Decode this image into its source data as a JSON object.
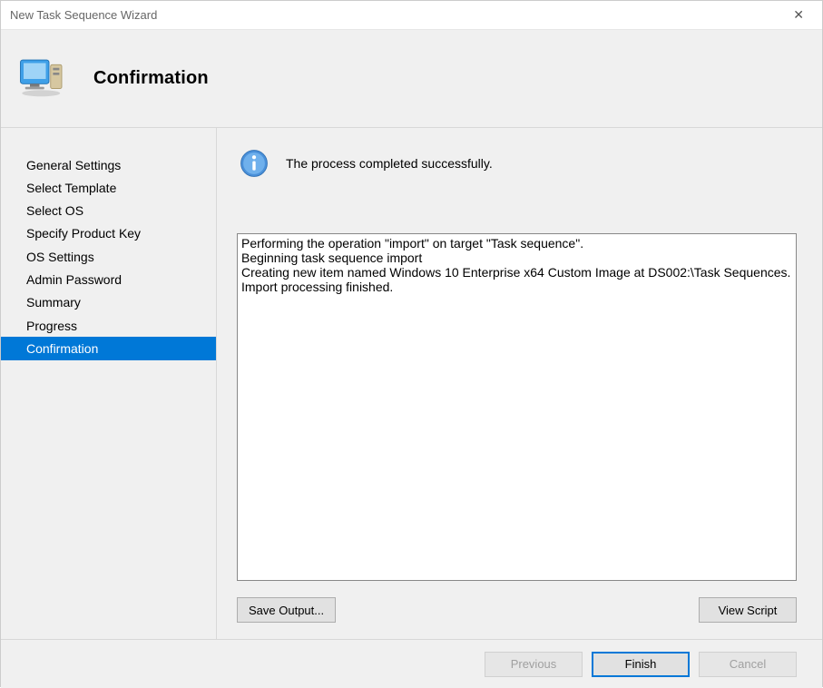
{
  "window": {
    "title": "New Task Sequence Wizard"
  },
  "header": {
    "title": "Confirmation"
  },
  "sidebar": {
    "items": [
      {
        "label": "General Settings",
        "selected": false
      },
      {
        "label": "Select Template",
        "selected": false
      },
      {
        "label": "Select OS",
        "selected": false
      },
      {
        "label": "Specify Product Key",
        "selected": false
      },
      {
        "label": "OS Settings",
        "selected": false
      },
      {
        "label": "Admin Password",
        "selected": false
      },
      {
        "label": "Summary",
        "selected": false
      },
      {
        "label": "Progress",
        "selected": false
      },
      {
        "label": "Confirmation",
        "selected": true
      }
    ]
  },
  "main": {
    "status_text": "The process completed successfully.",
    "log_text": "Performing the operation \"import\" on target \"Task sequence\".\nBeginning task sequence import\nCreating new item named Windows 10 Enterprise x64 Custom Image at DS002:\\Task Sequences.\nImport processing finished.",
    "save_output_label": "Save Output...",
    "view_script_label": "View Script"
  },
  "footer": {
    "previous_label": "Previous",
    "finish_label": "Finish",
    "cancel_label": "Cancel"
  }
}
